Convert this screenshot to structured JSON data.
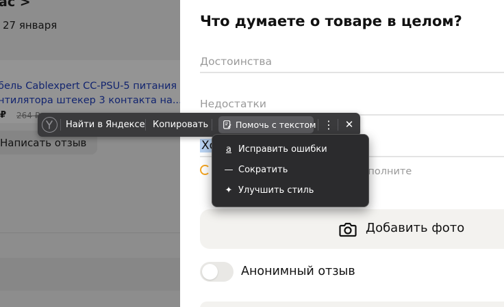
{
  "background_page": {
    "header_fragment": "ас >",
    "date": "27 января",
    "product_title_line1": "бель Cablexpert CC-PSU-5 питания",
    "product_title_line2": "нтилятора штекер 3 контакта на...",
    "price": "₽",
    "old_price": "264 ₽",
    "write_review_button": "Написать отзыв"
  },
  "review_panel": {
    "title": "Что думаете о товаре в целом?",
    "pros_placeholder": "Достоинства",
    "cons_placeholder": "Недостатки",
    "comment_value": "Хо",
    "hint_text": "о дополните",
    "add_photo_button": "Добавить фото",
    "anonymous_label": "Анонимный отзыв",
    "anonymous_enabled": false
  },
  "text_toolbar": {
    "search_button": "Найти в Яндексе",
    "copy_button": "Копировать",
    "help_button": "Помочь с текстом",
    "more_icon": "⋮",
    "close_icon": "✕"
  },
  "help_menu": {
    "items": [
      {
        "label": "Исправить ошибки",
        "icon": "spellcheck-icon",
        "glyph": "a"
      },
      {
        "label": "Сократить",
        "icon": "shorten-icon",
        "glyph": "—"
      },
      {
        "label": "Улучшить стиль",
        "icon": "sparkle-icon",
        "glyph": "✦"
      }
    ]
  },
  "colors": {
    "toolbar_bg": "#3a3a3c",
    "menu_bg": "#2b2b2d",
    "link_blue": "#1f3fbf",
    "selection": "#b9d3f3",
    "hint_orange": "#f5a623"
  }
}
